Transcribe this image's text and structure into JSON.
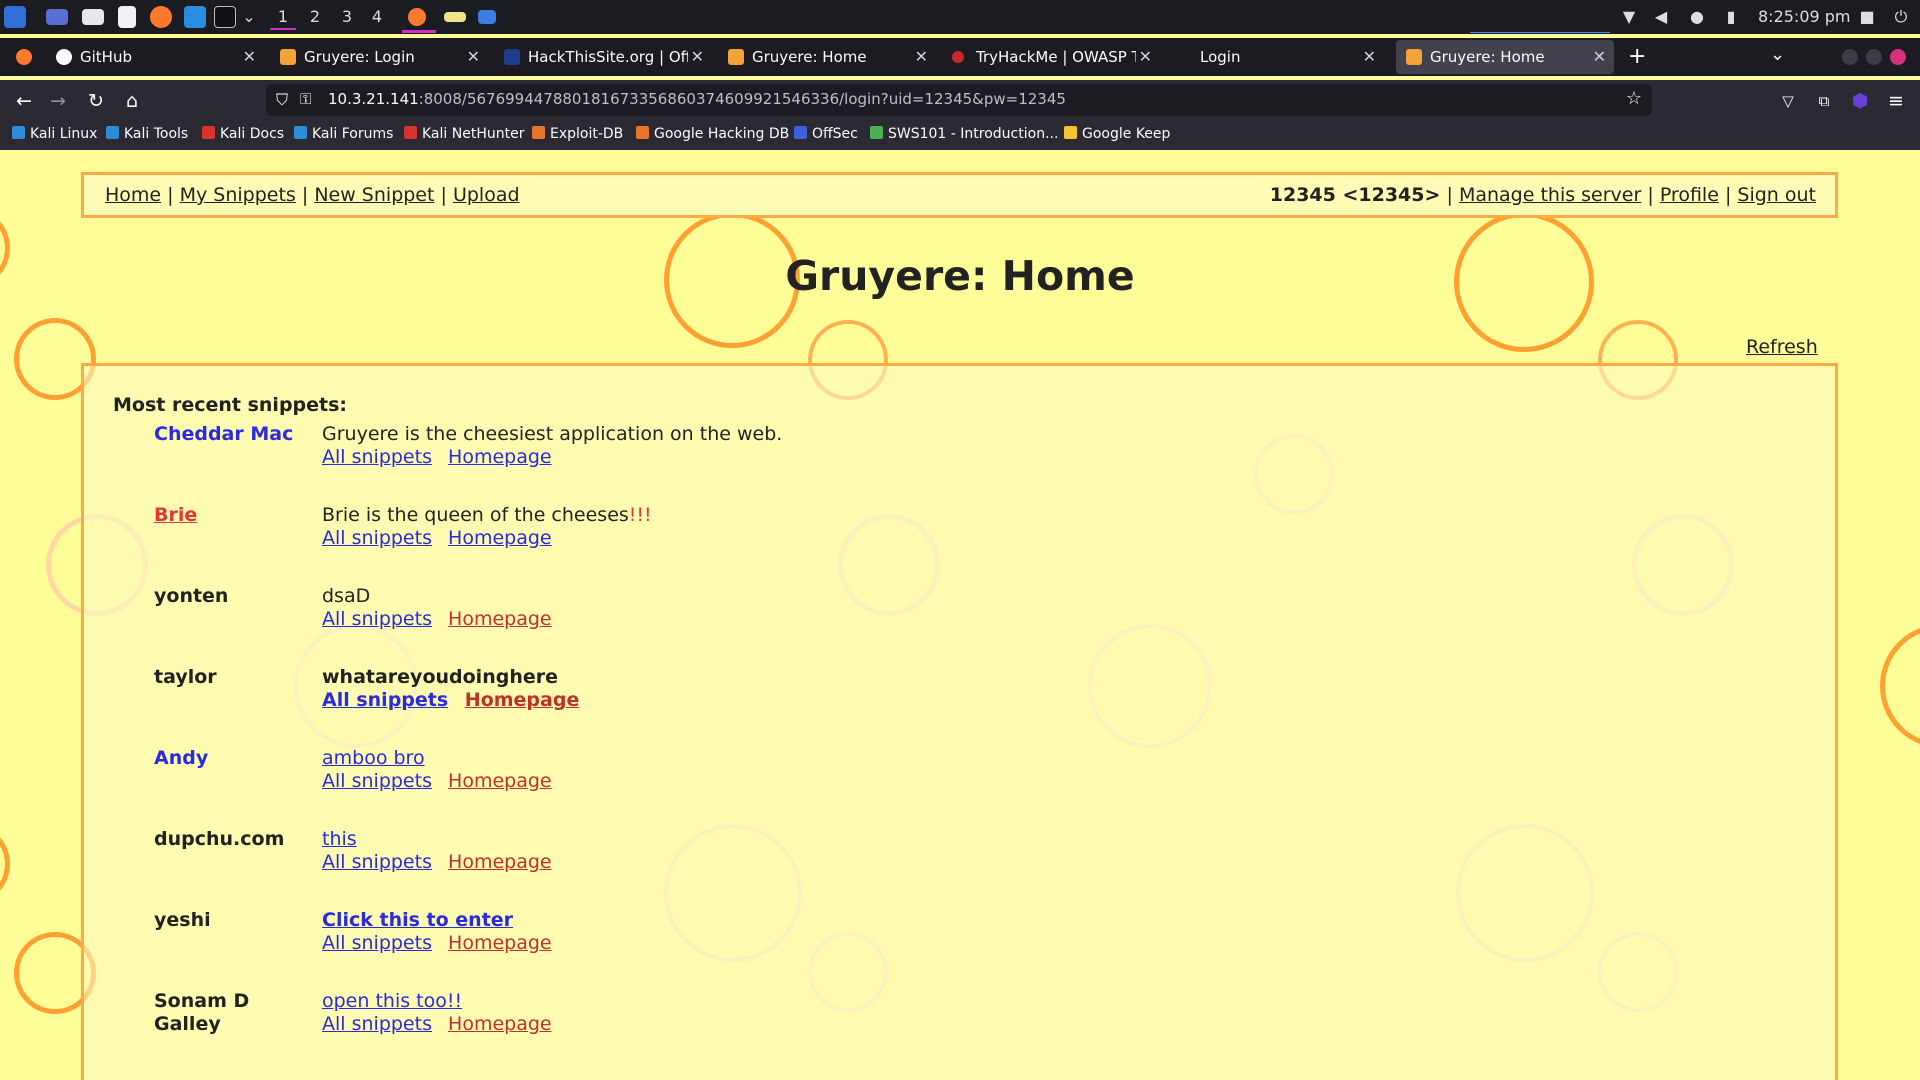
{
  "taskbar": {
    "workspaces": [
      "1",
      "2",
      "3",
      "4"
    ],
    "clock": "8:25:09 pm",
    "icons": [
      "kali-menu-icon",
      "desktop-icon",
      "files-icon",
      "text-editor-icon",
      "firefox-icon",
      "vscode-icon",
      "terminal-icon",
      "chevron-down-icon",
      "firefox-window-icon",
      "folder-window-icon",
      "app-window-icon",
      "wifi-icon",
      "volume-icon",
      "bell-icon",
      "battery-icon",
      "lock-icon",
      "power-icon"
    ]
  },
  "tabs": [
    {
      "label": "GitHub",
      "icon": "github-icon"
    },
    {
      "label": "Gruyere: Login",
      "icon": "gruyere-icon"
    },
    {
      "label": "HackThisSite.org | Offline",
      "icon": "hts-icon"
    },
    {
      "label": "Gruyere: Home",
      "icon": "gruyere-icon"
    },
    {
      "label": "TryHackMe | OWASP Top",
      "icon": "tryhackme-icon"
    },
    {
      "label": "Login",
      "icon": "none"
    },
    {
      "label": "Gruyere: Home",
      "icon": "gruyere-icon",
      "active": true
    }
  ],
  "address_bar": {
    "host": "10.3.21.141",
    "rest": ":8008/567699447880181673356860374609921546336/login?uid=12345&pw=12345"
  },
  "bookmarks": [
    {
      "label": "Kali Linux",
      "color": "#2d8cd8"
    },
    {
      "label": "Kali Tools",
      "color": "#2d8cd8"
    },
    {
      "label": "Kali Docs",
      "color": "#d8342d"
    },
    {
      "label": "Kali Forums",
      "color": "#2d8cd8"
    },
    {
      "label": "Kali NetHunter",
      "color": "#d8342d"
    },
    {
      "label": "Exploit-DB",
      "color": "#e8742a"
    },
    {
      "label": "Google Hacking DB",
      "color": "#e8742a"
    },
    {
      "label": "OffSec",
      "color": "#3e5fe0"
    },
    {
      "label": "SWS101 - Introduction...",
      "color": "#4caf50"
    },
    {
      "label": "Google Keep",
      "color": "#f6c431"
    }
  ],
  "menu": {
    "left": [
      "Home",
      "My Snippets",
      "New Snippet",
      "Upload"
    ],
    "user": "12345 <12345>",
    "right": [
      "Manage this server",
      "Profile",
      "Sign out"
    ]
  },
  "page_title": "Gruyere: Home",
  "refresh_label": "Refresh",
  "recent_heading": "Most recent snippets:",
  "snippets": [
    {
      "author": "Cheddar Mac",
      "text": "Gruyere is the cheesiest application on the web.",
      "all": "All snippets",
      "home": "Homepage"
    },
    {
      "author": "Brie",
      "text": "Brie is the queen of the cheeses",
      "text_red": "!!!",
      "all": "All snippets",
      "home": "Homepage"
    },
    {
      "author": "yonten",
      "text": "dsaD",
      "all": "All snippets",
      "home": "Homepage"
    },
    {
      "author": "taylor",
      "text": "whatareyoudoinghere",
      "all": "All snippets",
      "home": "Homepage"
    },
    {
      "author": "Andy",
      "text": "amboo bro",
      "all": "All snippets",
      "home": "Homepage"
    },
    {
      "author": "dupchu.com",
      "text": "this",
      "all": "All snippets",
      "home": "Homepage"
    },
    {
      "author": "yeshi",
      "text": "Click this to enter",
      "all": "All snippets",
      "home": "Homepage"
    },
    {
      "author_line1": "Sonam D",
      "author_line2": "Galley",
      "text": "open this too!!",
      "all": "All snippets",
      "home": "Homepage"
    }
  ],
  "colors": {
    "page_bg": "#fffd98",
    "border_orange": "#ffa947",
    "link_blue": "#2a2adf",
    "link_red": "#c0302a",
    "accent_red": "#e23737"
  }
}
